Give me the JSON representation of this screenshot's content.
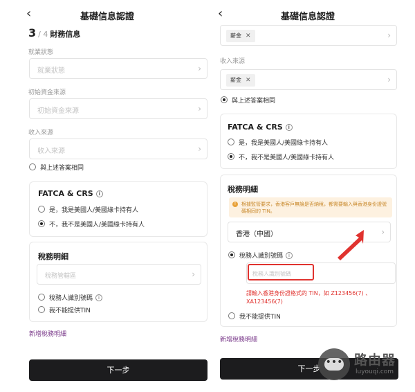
{
  "header": {
    "back_glyph": "‹",
    "title": "基礎信息認證"
  },
  "step": {
    "current": "3",
    "total": "/ 4",
    "label": "財務信息"
  },
  "left": {
    "employment": {
      "label": "就業狀態",
      "placeholder": "就業狀態"
    },
    "initial_funds": {
      "label": "初始資金來源",
      "placeholder": "初始資金來源"
    },
    "income": {
      "label": "收入來源",
      "placeholder": "收入來源"
    },
    "same_answer": "與上述答案相同",
    "fatca": {
      "title": "FATCA & CRS",
      "option_yes": "是，我是美國人/美國綠卡持有人",
      "option_no": "不，我不是美國人/美國綠卡持有人"
    },
    "tax": {
      "title": "稅務明細",
      "jurisdiction_placeholder": "稅務管轄區",
      "tin_option": "稅務人識別號碼",
      "no_tin_option": "我不能提供TIN"
    },
    "add_tax": "新增稅務明細",
    "next": "下一步"
  },
  "right": {
    "initial_funds_chip": "薪金",
    "income": {
      "label": "收入來源",
      "chip": "薪金"
    },
    "same_answer": "與上述答案相同",
    "fatca": {
      "title": "FATCA & CRS",
      "option_yes": "是，我是美國人/美國綠卡持有人",
      "option_no": "不，我不是美國人/美國綠卡持有人"
    },
    "tax": {
      "title": "稅務明細",
      "notice": "根據監管要求，香港客戶無論是否納稅，都需要輸入與香港身份證號碼相同的 TIN。",
      "jurisdiction_value": "香港（中國）",
      "tin_option": "稅務人識別號碼",
      "tin_placeholder": "稅務人識別號碼",
      "tin_error": "請輸入香港身份證格式的 TIN，如 Z123456(7) 、XA123456(7)",
      "no_tin_option": "我不能提供TIN"
    },
    "add_tax": "新增稅務明細",
    "next": "下一步"
  },
  "watermark": {
    "name": "路由器",
    "url": "luyouqi.com"
  },
  "colors": {
    "accent_link": "#7a3a8a",
    "error": "#e0332f",
    "button_bg": "#1c1c1e",
    "notice_bg": "#fdf1e0"
  }
}
